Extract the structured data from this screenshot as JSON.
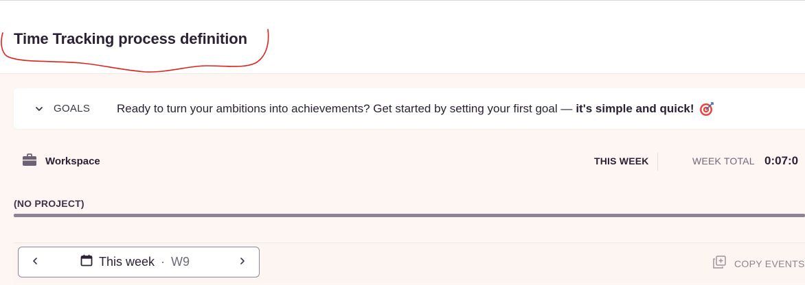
{
  "header": {
    "title": "Time Tracking process definition"
  },
  "goals": {
    "label": "GOALS",
    "message": "Ready to turn your ambitions into achievements? Get started by setting your first goal —",
    "message_bold": "it's simple and quick!",
    "toggle_icon": "chevron-down-icon",
    "emoji_icon": "target-icon"
  },
  "workspace": {
    "icon": "briefcase-icon",
    "label": "Workspace",
    "period_label": "THIS WEEK",
    "week_total_label": "WEEK TOTAL",
    "week_total_value": "0:07:0"
  },
  "project": {
    "label": "(NO PROJECT)"
  },
  "week_nav": {
    "prev_icon": "chevron-left-icon",
    "next_icon": "chevron-right-icon",
    "calendar_icon": "calendar-icon",
    "label": "This week",
    "separator": "·",
    "week_number": "W9"
  },
  "actions": {
    "copy_events_label": "COPY EVENTS",
    "copy_icon": "copy-icon"
  },
  "colors": {
    "annotation": "#e0201b",
    "text_primary": "#2a2135",
    "background": "#fdf6f2"
  }
}
